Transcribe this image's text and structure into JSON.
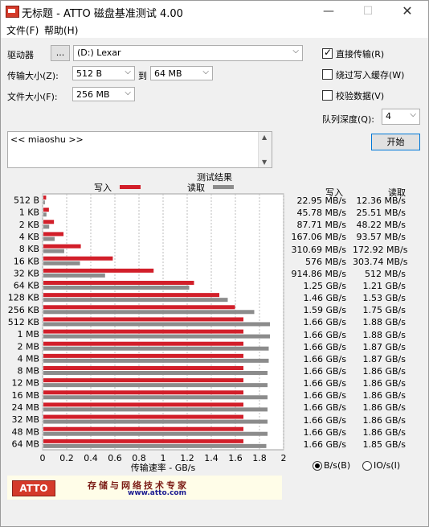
{
  "window": {
    "title": "无标题 - ATTO 磁盘基准测试 4.00",
    "minimize": "—",
    "maximize": "☐",
    "close": "✕"
  },
  "menu": {
    "file": "文件(F)",
    "help": "帮助(H)"
  },
  "controls": {
    "drive_label": "驱动器",
    "browse_label": "...",
    "drive_value": "(D:) Lexar",
    "transfer_label": "传输大小(Z):",
    "transfer_from": "512 B",
    "to_label": "到",
    "transfer_to": "64 MB",
    "file_size_label": "文件大小(F):",
    "file_size": "256 MB",
    "direct_io_label": "直接传输(R)",
    "direct_io_checked": true,
    "bypass_cache_label": "绕过写入缓存(W)",
    "bypass_cache_checked": false,
    "verify_label": "校验数据(V)",
    "verify_checked": false,
    "queue_label": "队列深度(Q):",
    "queue_value": "4",
    "start_label": "开始"
  },
  "description": {
    "text": "<< miaoshu >>"
  },
  "results": {
    "title": "测试结果",
    "write_header": "写入",
    "read_header": "读取",
    "unit_bs": "B/s(B)",
    "unit_ios": "IO/s(I)",
    "unit_selected": "B/s"
  },
  "chart_data": {
    "type": "bar",
    "orientation": "horizontal",
    "title": "测试结果",
    "xlabel": "传输速率 - GB/s",
    "xlim": [
      0,
      2
    ],
    "xticks": [
      "0",
      "0.2",
      "0.4",
      "0.6",
      "0.8",
      "1",
      "1.2",
      "1.4",
      "1.6",
      "1.8",
      "2"
    ],
    "grid": true,
    "legend": "top",
    "categories": [
      "512 B",
      "1 KB",
      "2 KB",
      "4 KB",
      "8 KB",
      "16 KB",
      "32 KB",
      "64 KB",
      "128 KB",
      "256 KB",
      "512 KB",
      "1 MB",
      "2 MB",
      "4 MB",
      "8 MB",
      "12 MB",
      "16 MB",
      "24 MB",
      "32 MB",
      "48 MB",
      "64 MB"
    ],
    "series": [
      {
        "name": "写入",
        "color": "#d21f2a",
        "values": [
          0.02295,
          0.04578,
          0.08771,
          0.167,
          0.31069,
          0.576,
          0.91486,
          1.25,
          1.46,
          1.59,
          1.66,
          1.66,
          1.66,
          1.66,
          1.66,
          1.66,
          1.66,
          1.66,
          1.66,
          1.66,
          1.66
        ],
        "labels": [
          "22.95 MB/s",
          "45.78 MB/s",
          "87.71 MB/s",
          "167.06 MB/s",
          "310.69 MB/s",
          "576 MB/s",
          "914.86 MB/s",
          "1.25 GB/s",
          "1.46 GB/s",
          "1.59 GB/s",
          "1.66 GB/s",
          "1.66 GB/s",
          "1.66 GB/s",
          "1.66 GB/s",
          "1.66 GB/s",
          "1.66 GB/s",
          "1.66 GB/s",
          "1.66 GB/s",
          "1.66 GB/s",
          "1.66 GB/s",
          "1.66 GB/s"
        ]
      },
      {
        "name": "读取",
        "color": "#8c8c8c",
        "values": [
          0.01236,
          0.02551,
          0.04822,
          0.09357,
          0.17292,
          0.30374,
          0.512,
          1.21,
          1.53,
          1.75,
          1.88,
          1.88,
          1.87,
          1.87,
          1.86,
          1.86,
          1.86,
          1.86,
          1.86,
          1.86,
          1.85
        ],
        "labels": [
          "12.36 MB/s",
          "25.51 MB/s",
          "48.22 MB/s",
          "93.57 MB/s",
          "172.92 MB/s",
          "303.74 MB/s",
          "512 MB/s",
          "1.21 GB/s",
          "1.53 GB/s",
          "1.75 GB/s",
          "1.88 GB/s",
          "1.88 GB/s",
          "1.87 GB/s",
          "1.87 GB/s",
          "1.86 GB/s",
          "1.86 GB/s",
          "1.86 GB/s",
          "1.86 GB/s",
          "1.86 GB/s",
          "1.86 GB/s",
          "1.85 GB/s"
        ]
      }
    ]
  },
  "banner": {
    "logo": "ATTO",
    "slogan": "存储与网络技术专家",
    "site": "www.atto.com"
  }
}
